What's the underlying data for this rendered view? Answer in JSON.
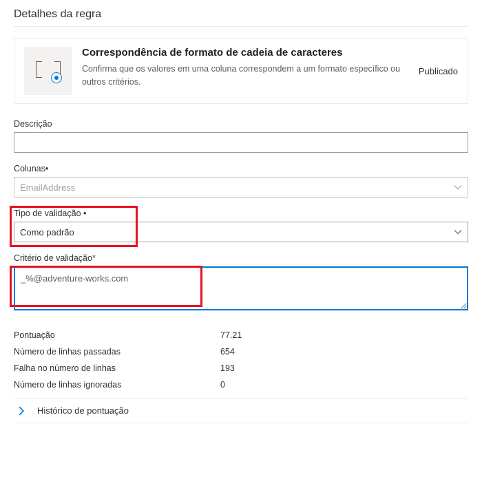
{
  "page": {
    "title": "Detalhes da regra"
  },
  "header": {
    "title": "Correspondência de formato de cadeia de caracteres",
    "description": "Confirma que os valores em uma coluna correspondem a um formato específico ou outros critérios.",
    "status": "Publicado"
  },
  "fields": {
    "description": {
      "label": "Descrição",
      "value": ""
    },
    "columns": {
      "label": "Colunas",
      "required_mark": "•",
      "value": "EmailAddress"
    },
    "validation_type": {
      "label": "Tipo de validação ",
      "required_mark": "•",
      "value": "Como padrão"
    },
    "validation_criteria": {
      "label": "Critério de validação",
      "required_mark": "*",
      "value": "_%@adventure-works.com"
    }
  },
  "stats": {
    "score": {
      "label": "Pontuação",
      "value": "77.21"
    },
    "passed": {
      "label": "Número de linhas passadas",
      "value": "654"
    },
    "failed": {
      "label": "Falha no número de linhas",
      "value": "193"
    },
    "ignored": {
      "label": "Número de linhas ignoradas",
      "value": "0"
    }
  },
  "sections": {
    "score_history": "Histórico de pontuação"
  }
}
